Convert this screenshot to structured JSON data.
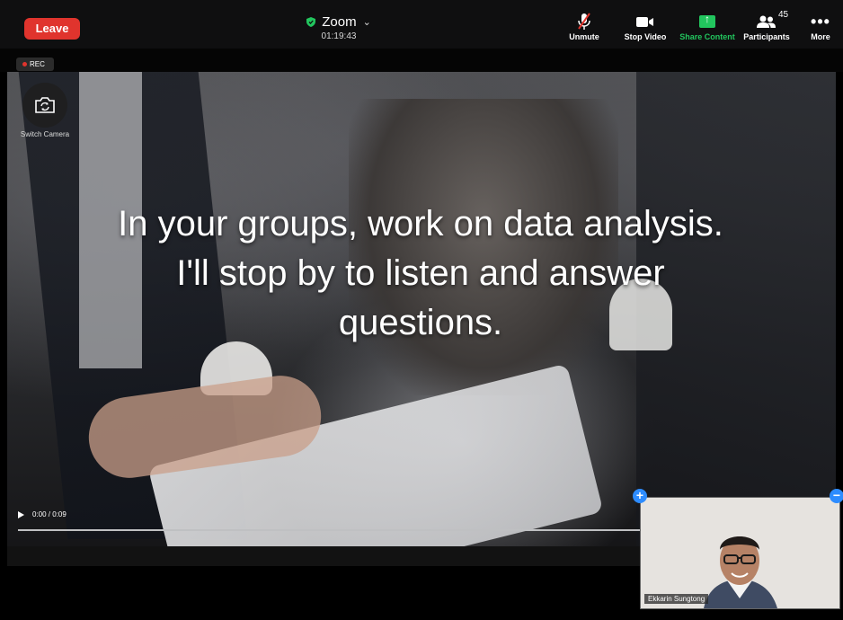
{
  "topbar": {
    "leave_label": "Leave",
    "app_title": "Zoom",
    "timer": "01:19:43",
    "unmute_label": "Unmute",
    "stop_video_label": "Stop Video",
    "share_content_label": "Share Content",
    "participants_label": "Participants",
    "participants_count": "45",
    "more_label": "More"
  },
  "stage": {
    "rec_label": "REC",
    "switch_camera_label": "Switch Camera",
    "overlay_lines": [
      "In your groups, work on data analysis.",
      "I'll stop by to listen and answer",
      "questions."
    ],
    "video_time": "0:00 / 0:09"
  },
  "self_view": {
    "name": "Ekkarin Sungtong"
  },
  "colors": {
    "leave": "#e0342d",
    "share_green": "#22c55e",
    "control_blue": "#2d8cff"
  }
}
